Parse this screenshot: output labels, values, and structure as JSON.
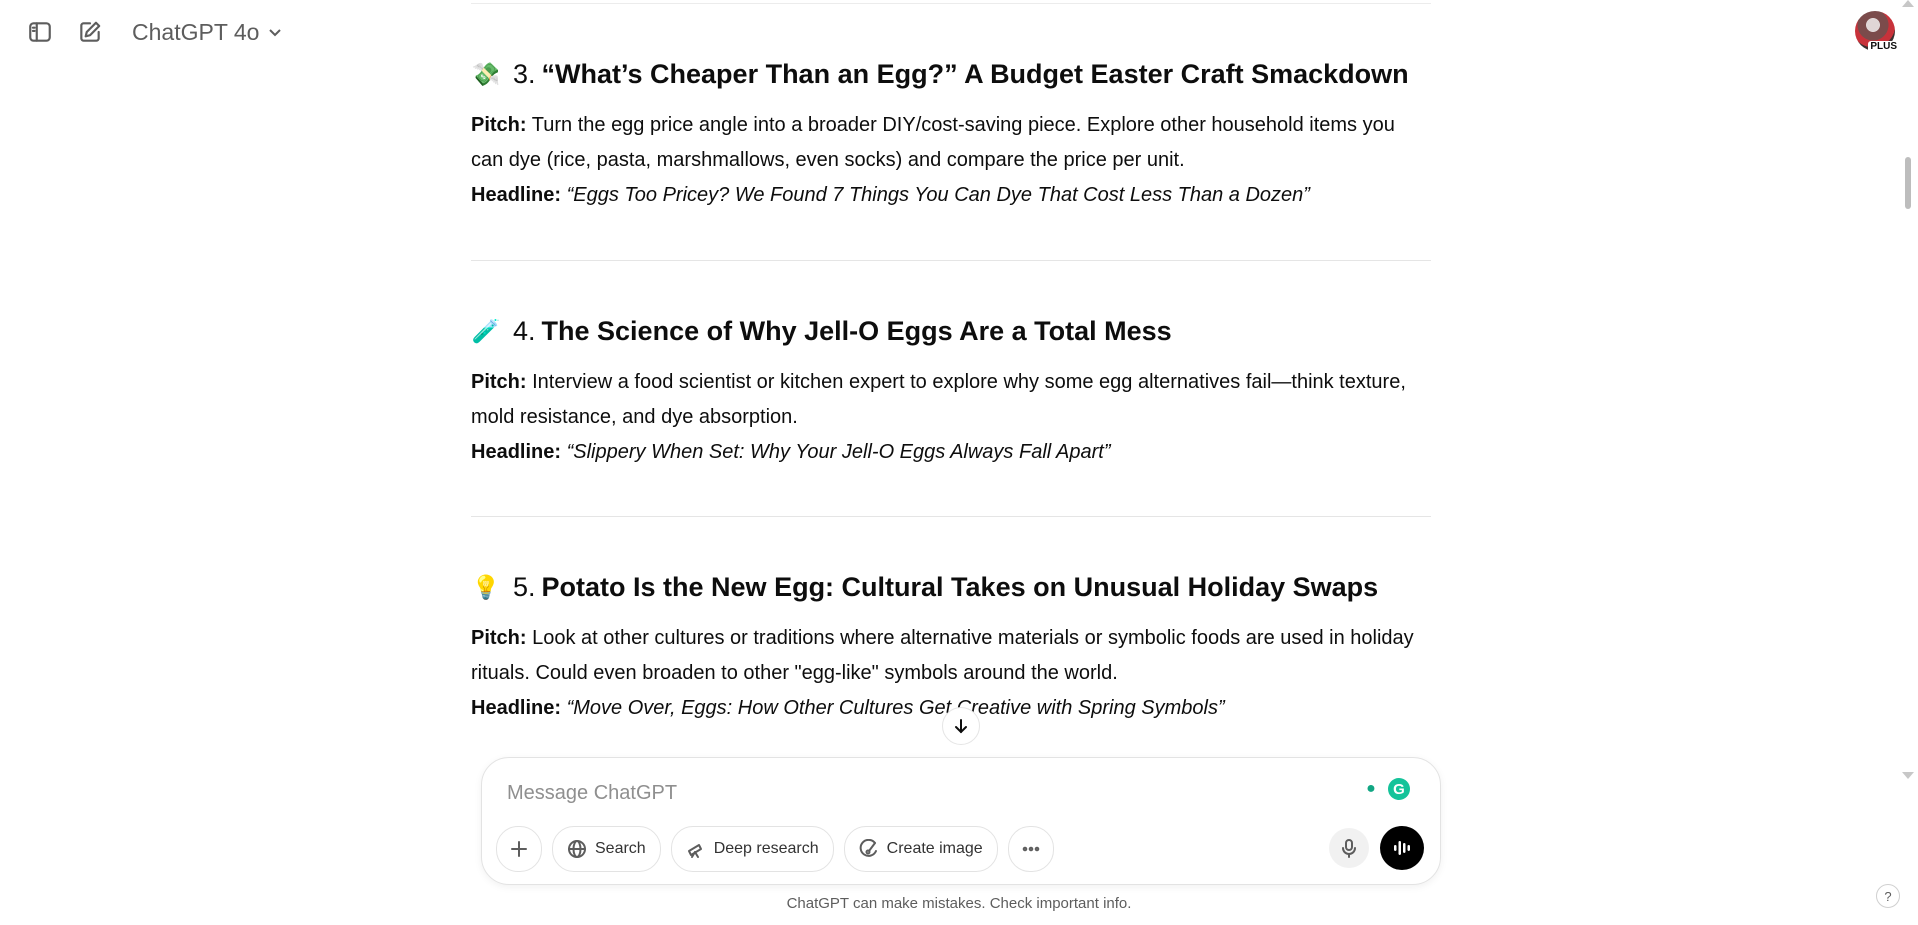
{
  "header": {
    "model_name": "ChatGPT 4o",
    "avatar_badge": "PLUS"
  },
  "sections": [
    {
      "emoji": "💸",
      "number": "3.",
      "title": "“What’s Cheaper Than an Egg?” A Budget Easter Craft Smackdown",
      "pitch_label": "Pitch:",
      "pitch": "Turn the egg price angle into a broader DIY/cost-saving piece. Explore other household items you can dye (rice, pasta, marshmallows, even socks) and compare the price per unit.",
      "headline_label": "Headline:",
      "headline": "“Eggs Too Pricey? We Found 7 Things You Can Dye That Cost Less Than a Dozen”"
    },
    {
      "emoji": "🧪",
      "number": "4.",
      "title": "The Science of Why Jell-O Eggs Are a Total Mess",
      "pitch_label": "Pitch:",
      "pitch": "Interview a food scientist or kitchen expert to explore why some egg alternatives fail—think texture, mold resistance, and dye absorption.",
      "headline_label": "Headline:",
      "headline": "“Slippery When Set: Why Your Jell-O Eggs Always Fall Apart”"
    },
    {
      "emoji": "💡",
      "number": "5.",
      "title": "Potato Is the New Egg: Cultural Takes on Unusual Holiday Swaps",
      "pitch_label": "Pitch:",
      "pitch": "Look at other cultures or traditions where alternative materials or symbolic foods are used in holiday rituals. Could even broaden to other \"egg-like\" symbols around the world.",
      "headline_label": "Headline:",
      "headline": "“Move Over, Eggs: How Other Cultures Get Creative with Spring Symbols”"
    }
  ],
  "composer": {
    "placeholder": "Message ChatGPT",
    "search_label": "Search",
    "deep_research_label": "Deep research",
    "create_image_label": "Create image",
    "grammarly_letter": "G"
  },
  "footer": {
    "disclaimer": "ChatGPT can make mistakes. Check important info.",
    "help": "?"
  },
  "icons": {
    "sidebar": "sidebar-toggle-icon",
    "compose": "new-chat-icon",
    "model_chevron": "chevron-down-icon",
    "scroll_down": "arrow-down-icon",
    "plus": "plus-icon",
    "globe": "globe-icon",
    "telescope": "telescope-icon",
    "image": "image-brush-icon",
    "more": "more-dots-icon",
    "mic": "microphone-icon",
    "voice": "voice-waveform-icon"
  },
  "colors": {
    "accent_voice": "#000000",
    "grammarly": "#15c39a",
    "text": "#0d0d0d",
    "muted": "#5d5d5d"
  }
}
